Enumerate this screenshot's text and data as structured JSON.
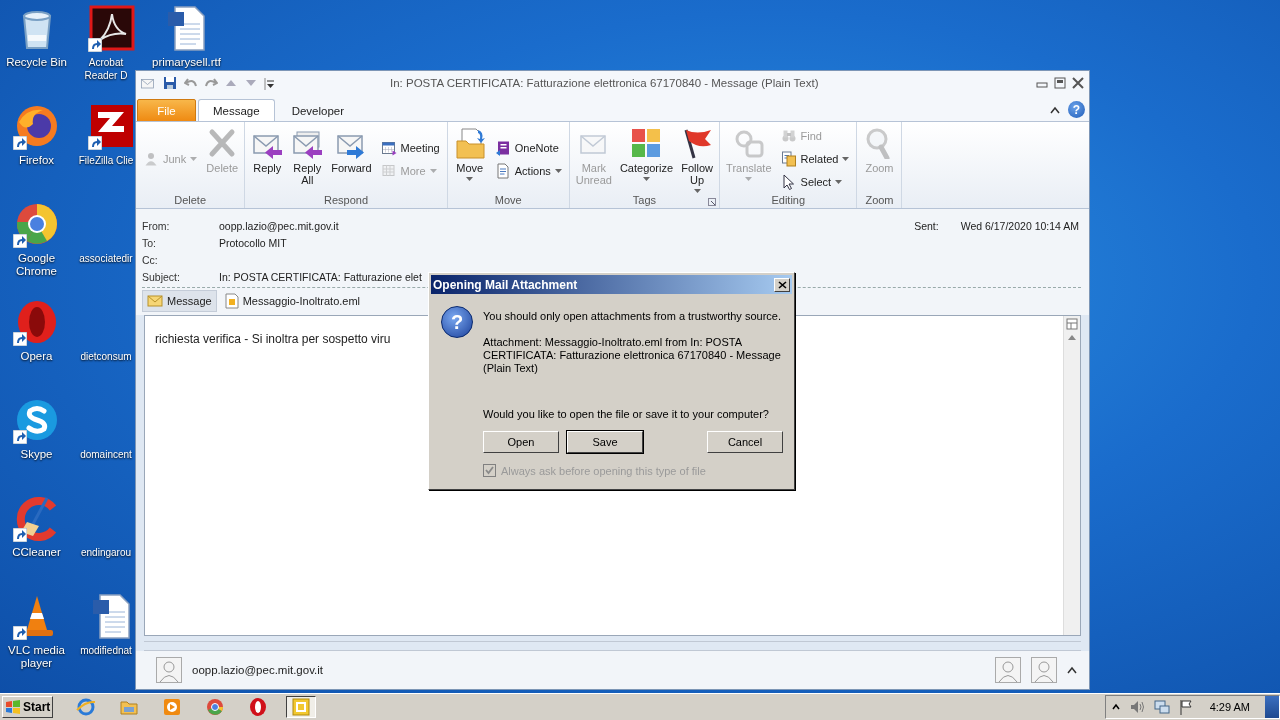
{
  "desktop": {
    "icons": [
      {
        "label": "Recycle Bin",
        "kind": "recycle",
        "shortcut": false
      },
      {
        "label": "Firefox",
        "kind": "firefox",
        "shortcut": true
      },
      {
        "label": "Google Chrome",
        "kind": "chrome",
        "shortcut": true
      },
      {
        "label": "Opera",
        "kind": "opera",
        "shortcut": true
      },
      {
        "label": "Skype",
        "kind": "skype",
        "shortcut": true
      },
      {
        "label": "CCleaner",
        "kind": "ccleaner",
        "shortcut": true
      },
      {
        "label": "VLC media player",
        "kind": "vlc",
        "shortcut": true
      },
      {
        "label": "Acrobat Reader D",
        "kind": "pdf",
        "shortcut": true
      },
      {
        "label": "FileZilla Clie",
        "kind": "filezilla",
        "shortcut": true
      },
      {
        "label": "associatedir",
        "kind": "blank",
        "shortcut": false
      },
      {
        "label": "dietconsum",
        "kind": "blank",
        "shortcut": false
      },
      {
        "label": "domaincent",
        "kind": "blank",
        "shortcut": false
      },
      {
        "label": "endingarou",
        "kind": "blank",
        "shortcut": false
      },
      {
        "label": "modifiednat",
        "kind": "doc",
        "shortcut": false
      },
      {
        "label": "primarysell.rtf",
        "kind": "doc",
        "shortcut": false
      }
    ]
  },
  "window": {
    "title": "In: POSTA CERTIFICATA: Fatturazione elettronica 67170840 - Message (Plain Text)",
    "help": "?",
    "tabs": [
      {
        "label": "File",
        "kind": "file",
        "selected": false
      },
      {
        "label": "Message",
        "kind": "tab",
        "selected": true
      },
      {
        "label": "Developer",
        "kind": "tab",
        "selected": false
      }
    ],
    "ribbon": {
      "groups": [
        {
          "label": "Delete",
          "launcher": false,
          "items": [
            {
              "label": "Junk",
              "kind": "small",
              "disabled": true,
              "dropdown": true
            },
            {
              "label": "Delete",
              "kind": "large",
              "disabled": true,
              "dropdown": false
            }
          ]
        },
        {
          "label": "Respond",
          "launcher": false,
          "items": [
            {
              "label": "Reply",
              "kind": "large",
              "disabled": false,
              "dropdown": false
            },
            {
              "label": "Reply All",
              "kind": "large",
              "disabled": false,
              "dropdown": false
            },
            {
              "label": "Forward",
              "kind": "large",
              "disabled": false,
              "dropdown": false
            },
            {
              "label": "Meeting",
              "kind": "small",
              "disabled": false,
              "dropdown": false
            },
            {
              "label": "More",
              "kind": "small",
              "disabled": true,
              "dropdown": true
            }
          ]
        },
        {
          "label": "Move",
          "launcher": false,
          "items": [
            {
              "label": "Move",
              "kind": "large",
              "disabled": false,
              "dropdown": true
            },
            {
              "label": "OneNote",
              "kind": "small",
              "disabled": false,
              "dropdown": false
            },
            {
              "label": "Actions",
              "kind": "small",
              "disabled": false,
              "dropdown": true
            }
          ]
        },
        {
          "label": "Tags",
          "launcher": true,
          "items": [
            {
              "label": "Mark Unread",
              "kind": "large",
              "disabled": true,
              "dropdown": false
            },
            {
              "label": "Categorize",
              "kind": "large",
              "disabled": false,
              "dropdown": true
            },
            {
              "label": "Follow Up",
              "kind": "large",
              "disabled": false,
              "dropdown": true
            }
          ]
        },
        {
          "label": "Editing",
          "launcher": false,
          "items": [
            {
              "label": "Translate",
              "kind": "large",
              "disabled": true,
              "dropdown": true
            },
            {
              "label": "Find",
              "kind": "small",
              "disabled": true,
              "dropdown": false
            },
            {
              "label": "Related",
              "kind": "small",
              "disabled": false,
              "dropdown": true
            },
            {
              "label": "Select",
              "kind": "small",
              "disabled": false,
              "dropdown": true
            }
          ]
        },
        {
          "label": "Zoom",
          "launcher": false,
          "items": [
            {
              "label": "Zoom",
              "kind": "large",
              "disabled": true,
              "dropdown": false
            }
          ]
        }
      ]
    },
    "header": {
      "fields": [
        {
          "label": "From:",
          "value": "oopp.lazio@pec.mit.gov.it"
        },
        {
          "label": "To:",
          "value": "Protocollo MIT"
        },
        {
          "label": "Cc:"
        },
        {
          "label": "Subject:",
          "value": "In: POSTA CERTIFICATA: Fatturazione elet"
        }
      ],
      "sent": {
        "label": "Sent:",
        "value": "Wed 6/17/2020 10:14 AM"
      }
    },
    "attachments": [
      {
        "label": "Message",
        "kind": "message",
        "selected": true
      },
      {
        "label": "Messaggio-Inoltrato.eml",
        "kind": "file",
        "selected": false
      }
    ],
    "body": "richiesta verifica - Si inoltra per sospetto viru",
    "people_pane": {
      "name": "oopp.lazio@pec.mit.gov.it"
    }
  },
  "dialog": {
    "title": "Opening Mail Attachment",
    "icon": "?",
    "warning": "You should only open attachments from a trustworthy source.",
    "details": "Attachment: Messaggio-Inoltrato.eml from In: POSTA CERTIFICATA: Fatturazione elettronica 67170840 - Message (Plain Text)",
    "question": "Would you like to open the file or save it to your computer?",
    "buttons": [
      {
        "label": "Open",
        "default": false
      },
      {
        "label": "Save",
        "default": true
      },
      {
        "label": "Cancel",
        "default": false
      }
    ],
    "checkbox": {
      "label": "Always ask before opening this type of file",
      "checked": true,
      "disabled": true
    }
  },
  "taskbar": {
    "start": "Start",
    "apps": [
      {
        "kind": "ie",
        "selected": false
      },
      {
        "kind": "folder",
        "selected": false
      },
      {
        "kind": "media",
        "selected": false
      },
      {
        "kind": "chrome",
        "selected": false
      },
      {
        "kind": "opera",
        "selected": false
      },
      {
        "kind": "outlook",
        "selected": true
      }
    ],
    "clock": "4:29 AM"
  }
}
